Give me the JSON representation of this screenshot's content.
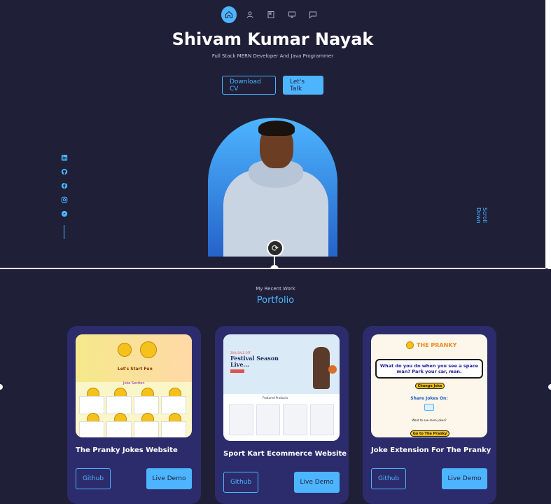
{
  "nav": {
    "items": [
      {
        "icon": "home-icon",
        "active": true
      },
      {
        "icon": "user-icon",
        "active": false
      },
      {
        "icon": "book-icon",
        "active": false
      },
      {
        "icon": "services-icon",
        "active": false
      },
      {
        "icon": "message-icon",
        "active": false
      }
    ]
  },
  "hero": {
    "name": "Shivam Kumar Nayak",
    "role": "Full Stack MERN Developer And Java Programmer",
    "download_cv": "Download CV",
    "lets_talk": "Let's Talk",
    "scroll_down": "Scroll Down"
  },
  "socials": [
    "linkedin-icon",
    "github-icon",
    "facebook-icon",
    "instagram-icon",
    "twitter-icon"
  ],
  "portfolio": {
    "subtitle": "My Recent Work",
    "title": "Portfolio",
    "projects": [
      {
        "title": "The Pranky Jokes Website",
        "github": "Github",
        "demo": "Live Demo"
      },
      {
        "title": "Sport Kart Ecommerce Website",
        "github": "Github",
        "demo": "Live Demo"
      },
      {
        "title": "Joke Extension For The Pranky",
        "github": "Github",
        "demo": "Live Demo"
      }
    ]
  },
  "previews": {
    "prank_tagline": "Let's Start Fun",
    "prank_section": "Joke Section",
    "sport_kicker": "20% SALE OFF",
    "sport_headline": "Festival Season Live...",
    "sport_featured": "Featured Products",
    "joke_brand": "THE PRANKY",
    "joke_text": "What do you do when you see a space man? Park your car, man.",
    "joke_change": "Change Joke",
    "joke_share": "Share Jokes On:",
    "joke_more": "Want to see more jokes?",
    "joke_go": "Go to The Pranky"
  },
  "colors": {
    "background": "#1f1f38",
    "accent": "#4db5ff",
    "card": "#2c2c6c"
  }
}
